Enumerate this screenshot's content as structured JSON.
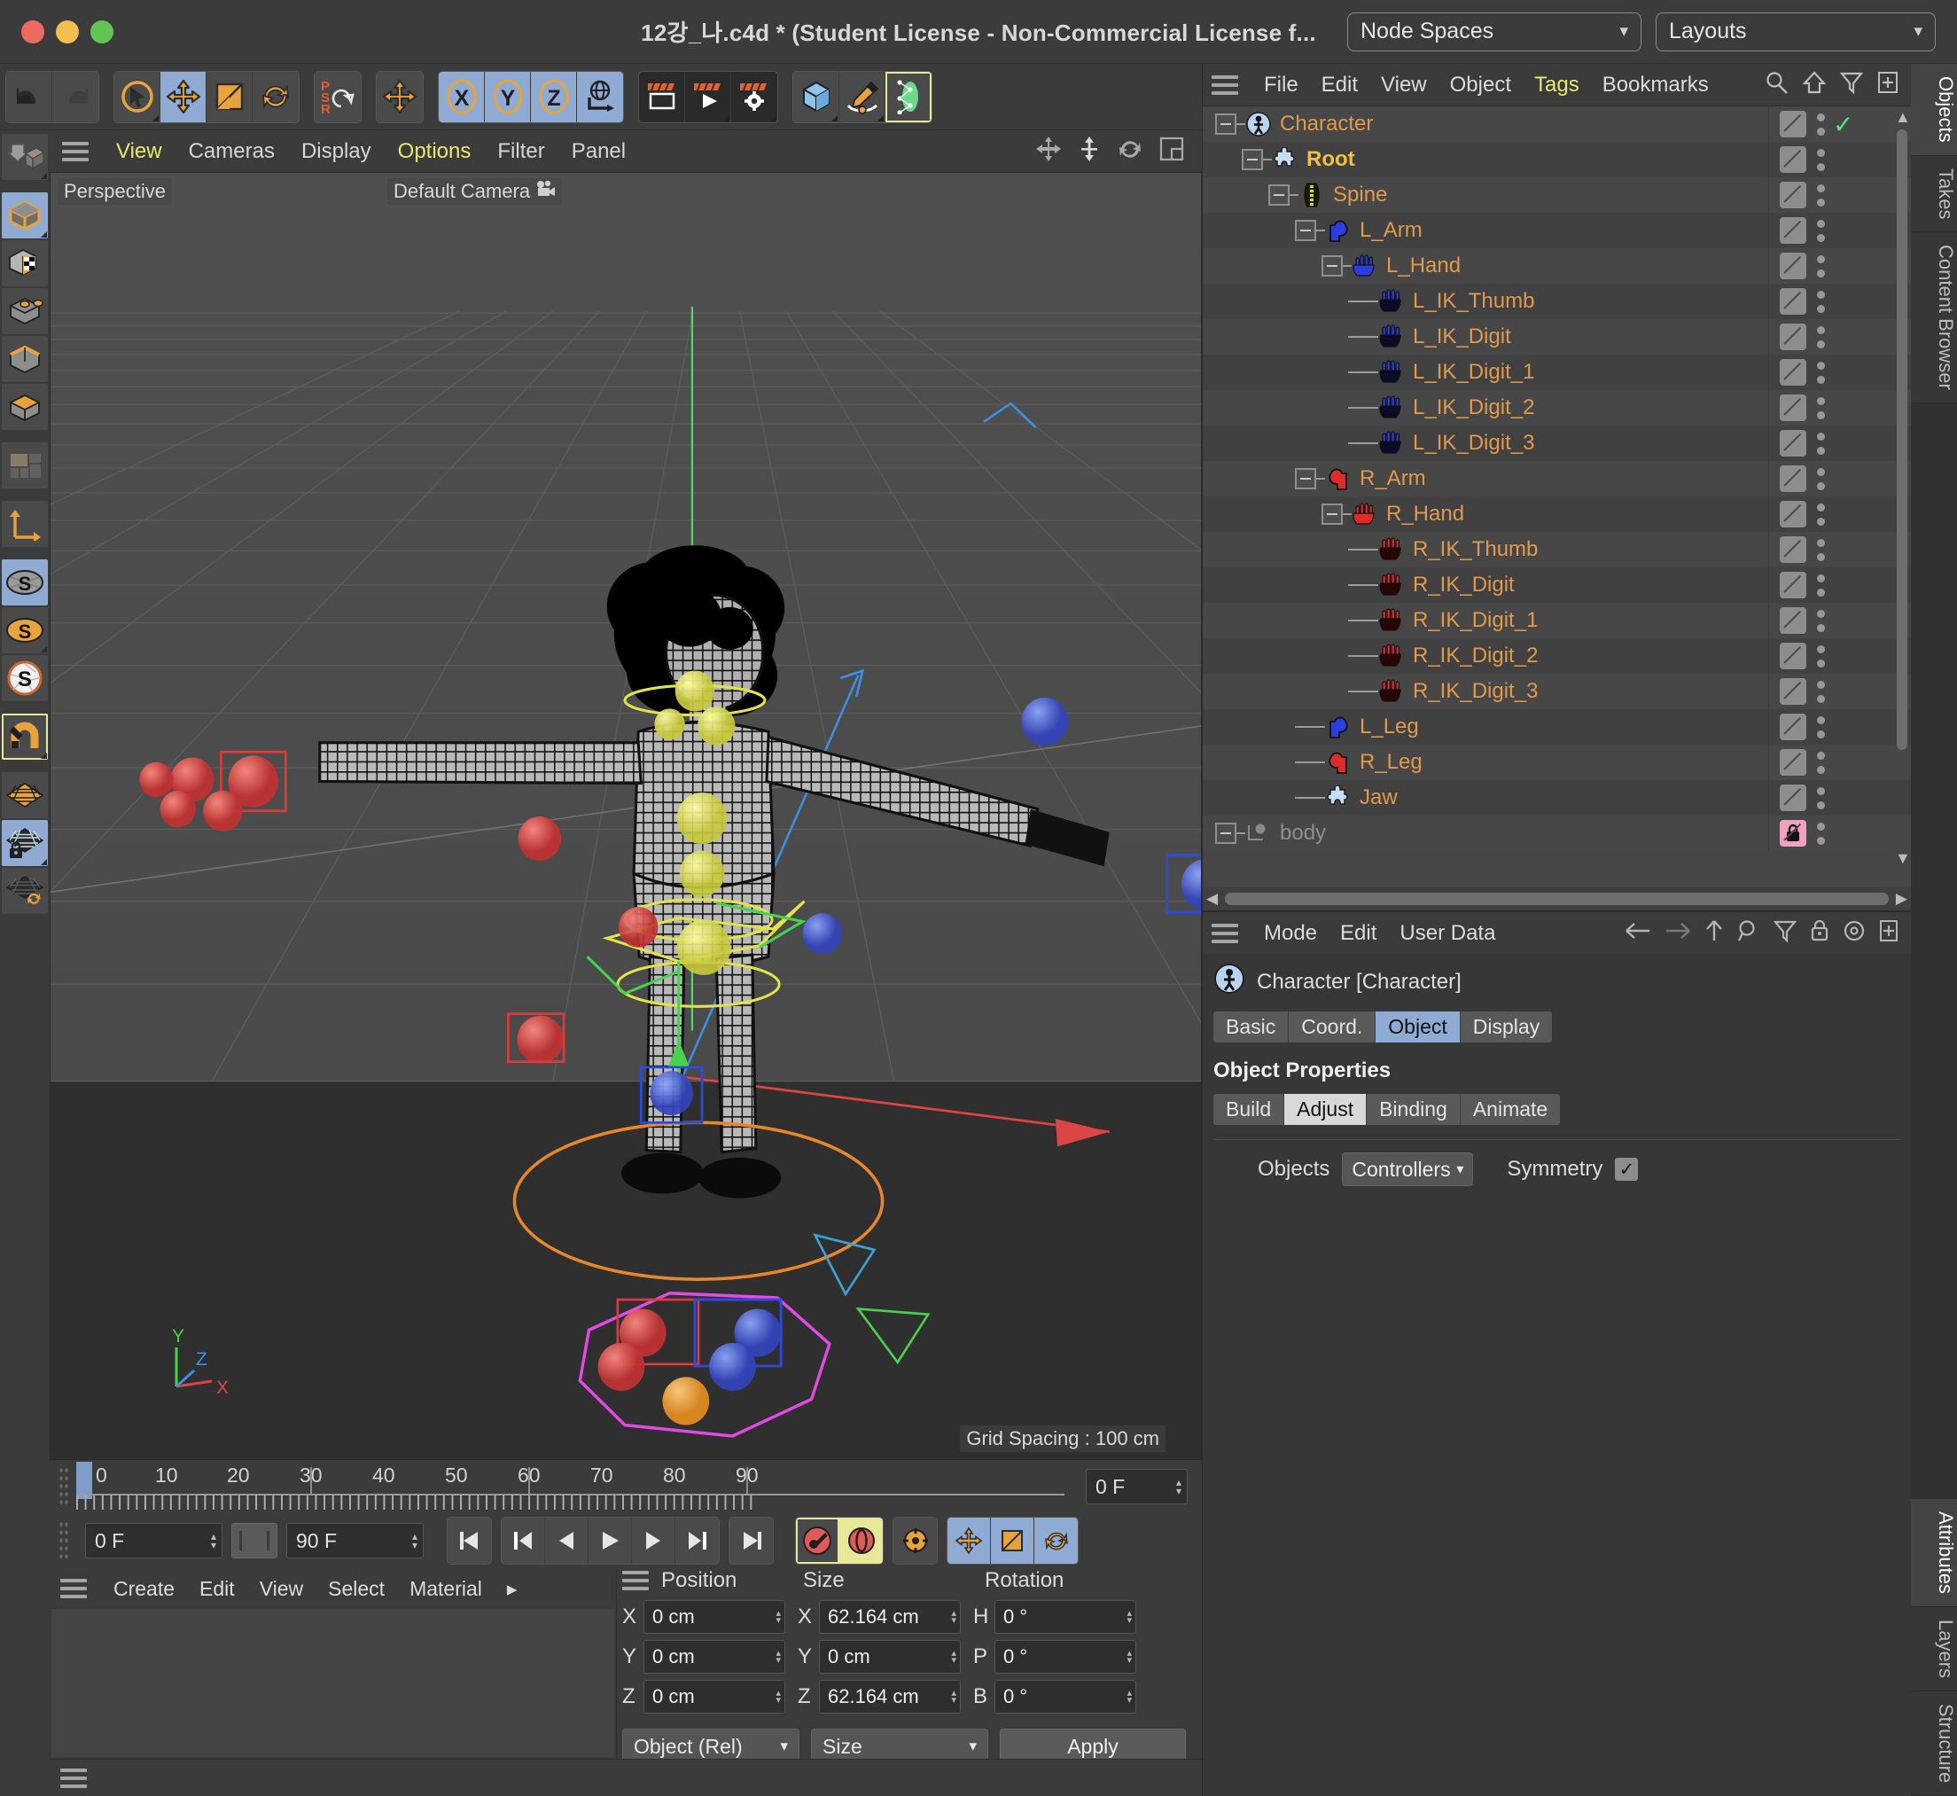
{
  "window": {
    "title": "12강_나.c4d * (Student License - Non-Commercial License f...",
    "node_spaces_label": "Node Spaces",
    "layouts_label": "Layouts"
  },
  "top_toolbar": {
    "groups": [
      {
        "name": "history",
        "buttons": [
          {
            "name": "undo-button",
            "icon": "undo-icon"
          },
          {
            "name": "redo-button",
            "icon": "redo-icon"
          }
        ]
      },
      {
        "name": "tools",
        "buttons": [
          {
            "name": "select-tool",
            "icon": "cursor-circle-icon"
          },
          {
            "name": "move-tool",
            "icon": "move-arrows-icon",
            "selected": true
          },
          {
            "name": "scale-tool",
            "icon": "scale-box-icon"
          },
          {
            "name": "rotate-tool",
            "icon": "rotate-arrows-icon"
          }
        ]
      },
      {
        "name": "psr",
        "buttons": [
          {
            "name": "psr-toggle",
            "icon": "psr-icon"
          }
        ]
      },
      {
        "name": "world-axis",
        "buttons": [
          {
            "name": "world-axis-button",
            "icon": "move-arrows-icon"
          }
        ]
      },
      {
        "name": "axis-locks",
        "buttons": [
          {
            "name": "lock-x-axis",
            "icon": "x-axis-icon",
            "label": "X",
            "selected": true
          },
          {
            "name": "lock-y-axis",
            "icon": "y-axis-icon",
            "label": "Y",
            "selected": true
          },
          {
            "name": "lock-z-axis",
            "icon": "z-axis-icon",
            "label": "Z",
            "selected": true
          },
          {
            "name": "world-coordinate-toggle",
            "icon": "globe-axis-icon",
            "selected": true
          }
        ]
      },
      {
        "name": "render",
        "buttons": [
          {
            "name": "render-view-button",
            "icon": "render-frame-icon"
          },
          {
            "name": "render-to-picture-viewer-button",
            "icon": "render-play-icon"
          },
          {
            "name": "render-settings-button",
            "icon": "render-gear-icon"
          }
        ]
      },
      {
        "name": "creation",
        "buttons": [
          {
            "name": "add-cube-button",
            "icon": "cube-icon"
          },
          {
            "name": "spline-pen-button",
            "icon": "pen-icon"
          },
          {
            "name": "character-object-button",
            "icon": "character-rig-icon",
            "highlight": true
          }
        ]
      }
    ]
  },
  "left_toolbar": {
    "items": [
      {
        "name": "make-editable-button",
        "icon": "make-editable-icon"
      },
      {
        "name": "model-mode-button",
        "icon": "model-cube-icon",
        "selected": true
      },
      {
        "name": "texture-mode-button",
        "icon": "texture-cube-icon"
      },
      {
        "name": "point-mode-button",
        "icon": "point-mode-icon"
      },
      {
        "name": "edge-mode-button",
        "icon": "edge-mode-icon"
      },
      {
        "name": "polygon-mode-button",
        "icon": "polygon-mode-icon"
      },
      {
        "name": "uv-mode-button",
        "icon": "uv-mode-icon"
      },
      {
        "name": "axis-mode-button",
        "icon": "axis-mode-icon"
      },
      {
        "name": "enable-axis-modification-button",
        "icon": "s-disc-gray-icon",
        "selected": true
      },
      {
        "name": "soft-selection-button",
        "icon": "s-disc-orange-icon"
      },
      {
        "name": "viewport-solo-button",
        "icon": "s-disc-white-icon"
      },
      {
        "name": "snap-toggle-button",
        "icon": "magnet-icon",
        "highlight": true
      },
      {
        "name": "workplane-button",
        "icon": "grid-orange-icon"
      },
      {
        "name": "lock-workplane-button",
        "icon": "grid-lock-icon",
        "selected": true
      },
      {
        "name": "align-workplane-button",
        "icon": "grid-rotate-icon"
      }
    ]
  },
  "viewport": {
    "menu": [
      {
        "label": "View",
        "active": true
      },
      {
        "label": "Cameras",
        "active": false
      },
      {
        "label": "Display",
        "active": false
      },
      {
        "label": "Options",
        "active": true
      },
      {
        "label": "Filter",
        "active": false
      },
      {
        "label": "Panel",
        "active": false
      }
    ],
    "projection_label": "Perspective",
    "camera_label": "Default Camera",
    "grid_spacing_label": "Grid Spacing : 100 cm",
    "axis_gizmo": {
      "x": "X",
      "y": "Y",
      "z": "Z"
    },
    "header_icons": [
      "move-view-icon",
      "zoom-view-icon",
      "rotate-view-icon",
      "maximize-view-icon"
    ]
  },
  "timeline": {
    "ticks": [
      "0",
      "10",
      "20",
      "30",
      "40",
      "50",
      "60",
      "70",
      "80",
      "90"
    ],
    "current_frame_field": "0 F",
    "start_frame_field": "0 F",
    "end_frame_field": "90 F",
    "playhead_frame": 0,
    "transport": [
      {
        "name": "go-to-start-button",
        "icon": "skip-start-icon"
      },
      {
        "name": "previous-key-button",
        "icon": "prev-key-icon"
      },
      {
        "name": "step-back-button",
        "icon": "step-back-icon"
      },
      {
        "name": "play-button",
        "icon": "play-icon"
      },
      {
        "name": "step-forward-button",
        "icon": "step-forward-icon"
      },
      {
        "name": "next-key-button",
        "icon": "next-key-icon"
      },
      {
        "name": "go-to-end-button",
        "icon": "skip-end-icon"
      }
    ],
    "record_buttons": [
      {
        "name": "record-active-objects-button",
        "icon": "record-key-icon"
      },
      {
        "name": "autokeying-button",
        "icon": "autokey-icon"
      },
      {
        "name": "keyframe-settings-button",
        "icon": "key-gear-icon"
      }
    ],
    "key_channel_buttons": [
      {
        "name": "record-position-button",
        "icon": "move-arrows-icon"
      },
      {
        "name": "record-scale-button",
        "icon": "scale-box-icon"
      },
      {
        "name": "record-rotation-button",
        "icon": "rotate-arrows-icon"
      }
    ]
  },
  "material_manager": {
    "menu": [
      "Create",
      "Edit",
      "View",
      "Select",
      "Material"
    ],
    "more_label": "▸"
  },
  "coordinates": {
    "headers": {
      "position": "Position",
      "size": "Size",
      "rotation": "Rotation"
    },
    "rows": [
      {
        "pos_label": "X",
        "pos_value": "0 cm",
        "size_label": "X",
        "size_value": "62.164 cm",
        "rot_label": "H",
        "rot_value": "0 °"
      },
      {
        "pos_label": "Y",
        "pos_value": "0 cm",
        "size_label": "Y",
        "size_value": "0 cm",
        "rot_label": "P",
        "rot_value": "0 °"
      },
      {
        "pos_label": "Z",
        "pos_value": "0 cm",
        "size_label": "Z",
        "size_value": "62.164 cm",
        "rot_label": "B",
        "rot_value": "0 °"
      }
    ],
    "mode_dropdown": "Object (Rel)",
    "size_dropdown": "Size",
    "apply_label": "Apply"
  },
  "object_manager": {
    "menu": [
      {
        "label": "File",
        "active": false
      },
      {
        "label": "Edit",
        "active": false
      },
      {
        "label": "View",
        "active": false
      },
      {
        "label": "Object",
        "active": false
      },
      {
        "label": "Tags",
        "active": true
      },
      {
        "label": "Bookmarks",
        "active": false
      }
    ],
    "icons": [
      "search-icon",
      "home-arrow-icon",
      "filter-icon",
      "add-panel-icon"
    ],
    "tree": [
      {
        "label": "Character",
        "depth": 0,
        "icon": "character-icon",
        "expander": true,
        "style": "normal",
        "check": true
      },
      {
        "label": "Root",
        "depth": 1,
        "icon": "puzzle-blue-icon",
        "expander": true,
        "style": "root"
      },
      {
        "label": "Spine",
        "depth": 2,
        "icon": "spine-icon",
        "expander": true,
        "style": "normal"
      },
      {
        "label": "L_Arm",
        "depth": 3,
        "icon": "arm-blue-icon",
        "expander": true,
        "style": "normal"
      },
      {
        "label": "L_Hand",
        "depth": 4,
        "icon": "hand-blue-icon",
        "expander": true,
        "style": "normal"
      },
      {
        "label": "L_IK_Thumb",
        "depth": 5,
        "icon": "hand-blue-dark-icon",
        "expander": false,
        "style": "normal"
      },
      {
        "label": "L_IK_Digit",
        "depth": 5,
        "icon": "hand-blue-dark-icon",
        "expander": false,
        "style": "normal"
      },
      {
        "label": "L_IK_Digit_1",
        "depth": 5,
        "icon": "hand-blue-dark-icon",
        "expander": false,
        "style": "normal"
      },
      {
        "label": "L_IK_Digit_2",
        "depth": 5,
        "icon": "hand-blue-dark-icon",
        "expander": false,
        "style": "normal"
      },
      {
        "label": "L_IK_Digit_3",
        "depth": 5,
        "icon": "hand-blue-dark-icon",
        "expander": false,
        "style": "normal"
      },
      {
        "label": "R_Arm",
        "depth": 3,
        "icon": "arm-red-icon",
        "expander": true,
        "style": "normal"
      },
      {
        "label": "R_Hand",
        "depth": 4,
        "icon": "hand-red-icon",
        "expander": true,
        "style": "normal"
      },
      {
        "label": "R_IK_Thumb",
        "depth": 5,
        "icon": "hand-red-dark-icon",
        "expander": false,
        "style": "normal"
      },
      {
        "label": "R_IK_Digit",
        "depth": 5,
        "icon": "hand-red-dark-icon",
        "expander": false,
        "style": "normal"
      },
      {
        "label": "R_IK_Digit_1",
        "depth": 5,
        "icon": "hand-red-dark-icon",
        "expander": false,
        "style": "normal"
      },
      {
        "label": "R_IK_Digit_2",
        "depth": 5,
        "icon": "hand-red-dark-icon",
        "expander": false,
        "style": "normal"
      },
      {
        "label": "R_IK_Digit_3",
        "depth": 5,
        "icon": "hand-red-dark-icon",
        "expander": false,
        "style": "normal"
      },
      {
        "label": "L_Leg",
        "depth": 3,
        "icon": "arm-blue-icon",
        "expander": false,
        "style": "normal"
      },
      {
        "label": "R_Leg",
        "depth": 3,
        "icon": "arm-red-icon",
        "expander": false,
        "style": "normal"
      },
      {
        "label": "Jaw",
        "depth": 3,
        "icon": "puzzle-blue-icon",
        "expander": false,
        "style": "normal"
      },
      {
        "label": "body",
        "depth": 0,
        "icon": "null-object-icon",
        "expander": true,
        "style": "dim",
        "lock": true
      }
    ]
  },
  "attributes": {
    "menu": [
      "Mode",
      "Edit",
      "User Data"
    ],
    "icons": [
      "back-arrow-icon",
      "forward-arrow-icon",
      "up-arrow-icon",
      "search-icon",
      "filter-icon",
      "lock-icon",
      "pin-icon",
      "add-panel-icon"
    ],
    "object_title": "Character [Character]",
    "tabs": [
      {
        "label": "Basic",
        "selected": false
      },
      {
        "label": "Coord.",
        "selected": false
      },
      {
        "label": "Object",
        "selected": true
      },
      {
        "label": "Display",
        "selected": false
      }
    ],
    "section_title": "Object Properties",
    "subtabs": [
      {
        "label": "Build",
        "selected": false
      },
      {
        "label": "Adjust",
        "selected": true
      },
      {
        "label": "Binding",
        "selected": false
      },
      {
        "label": "Animate",
        "selected": false
      }
    ],
    "objects_label": "Objects",
    "objects_value": "Controllers",
    "symmetry_label": "Symmetry",
    "symmetry_checked": true
  },
  "side_tabs": {
    "upper": [
      {
        "label": "Objects",
        "selected": true
      },
      {
        "label": "Takes",
        "selected": false
      },
      {
        "label": "Content Browser",
        "selected": false
      }
    ],
    "lower": [
      {
        "label": "Attributes",
        "selected": true
      },
      {
        "label": "Layers",
        "selected": false
      },
      {
        "label": "Structure",
        "selected": false
      }
    ]
  },
  "colors": {
    "accent_orange": "#e09a4e",
    "accent_blue": "#8fabd4",
    "accent_yellow": "#e9e96e",
    "panel_bg": "#373737",
    "viewport_bg": "#4b4b4b"
  }
}
